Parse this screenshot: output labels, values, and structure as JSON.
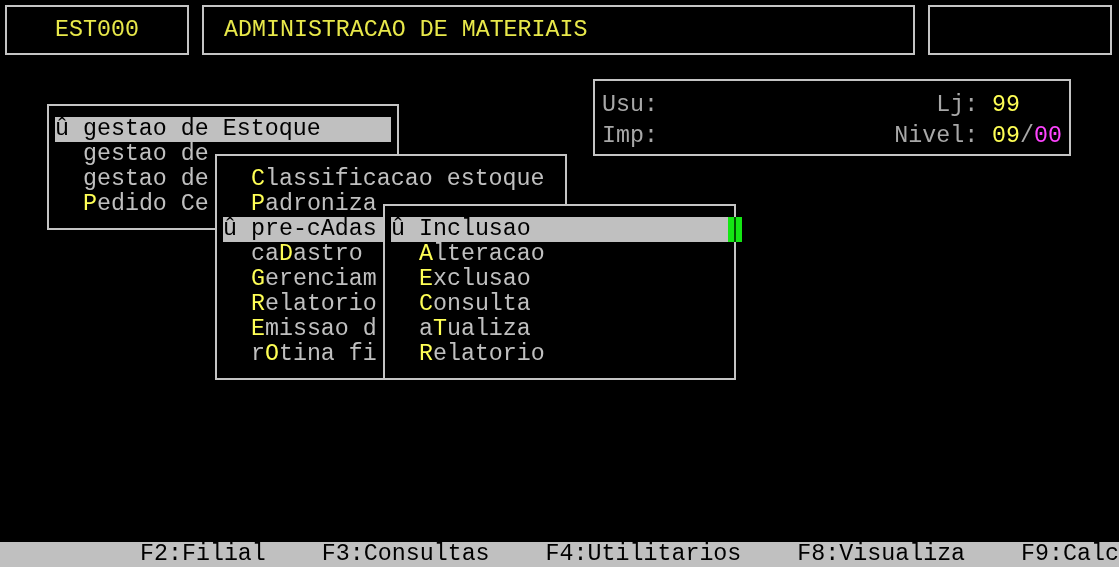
{
  "header": {
    "code": "EST000",
    "title": "ADMINISTRACAO DE MATERIAIS"
  },
  "info": {
    "user_label": "Usu:",
    "printer_label": "Imp:",
    "store": {
      "label": "Lj:",
      "value": "99"
    },
    "level": {
      "label": "Nivel:",
      "parts": [
        {
          "text": "09",
          "color": "#ffff55"
        },
        {
          "text": "/",
          "color": "#a8a8a8"
        },
        {
          "text": "00",
          "color": "#ff44ff"
        }
      ]
    }
  },
  "menus": [
    {
      "marker": "û",
      "cursor": false,
      "items": [
        {
          "label": "gestao de **E**stoque",
          "selected": true
        },
        {
          "label": "gestao de",
          "selected": false
        },
        {
          "label": "gestao de",
          "selected": false
        },
        {
          "label": "**P**edido Ce",
          "selected": false
        }
      ]
    },
    {
      "marker": "û",
      "cursor": false,
      "items": [
        {
          "label": "**C**lassificacao estoque",
          "selected": false
        },
        {
          "label": "**P**adroniza",
          "selected": false
        },
        {
          "label": "pre-c**A**das",
          "selected": true
        },
        {
          "label": "ca**D**astro",
          "selected": false
        },
        {
          "label": "**G**erenciam",
          "selected": false
        },
        {
          "label": "**R**elatorio",
          "selected": false
        },
        {
          "label": "**E**missao d",
          "selected": false
        },
        {
          "label": "r**O**tina fi",
          "selected": false
        }
      ]
    },
    {
      "marker": "û",
      "cursor": true,
      "items": [
        {
          "label": "**I**nclusao",
          "selected": true
        },
        {
          "label": "**A**lteracao",
          "selected": false
        },
        {
          "label": "**E**xclusao",
          "selected": false
        },
        {
          "label": "**C**onsulta",
          "selected": false
        },
        {
          "label": "a**T**ualiza",
          "selected": false
        },
        {
          "label": "**R**elatorio",
          "selected": false
        }
      ]
    }
  ],
  "function_keys": [
    "F2:Filial",
    "F3:Consultas",
    "F4:Utilitarios",
    "F8:Visualiza",
    "F9:Calc"
  ]
}
